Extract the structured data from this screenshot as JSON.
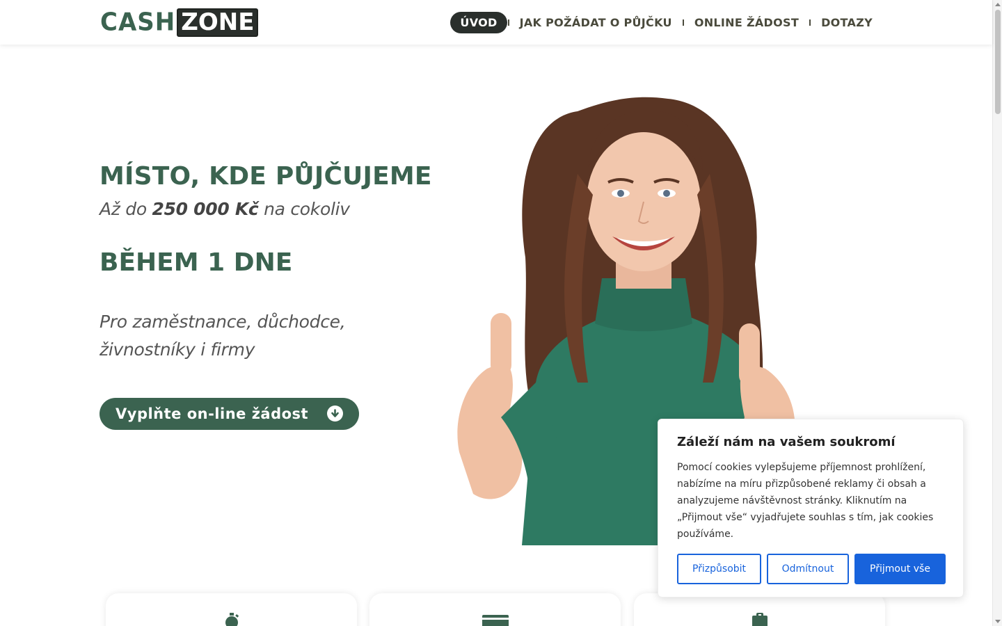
{
  "header": {
    "logo": {
      "part1": "CASH",
      "part2": "ZONE"
    },
    "nav": [
      {
        "label": "ÚVOD",
        "active": true
      },
      {
        "label": "JAK POŽÁDAT O PŮJČKU",
        "active": false
      },
      {
        "label": "ONLINE ŽÁDOST",
        "active": false
      },
      {
        "label": "DOTAZY",
        "active": false
      }
    ]
  },
  "hero": {
    "title": "MÍSTO, KDE PŮJČUJEME",
    "subtitle_pre": "Až do ",
    "subtitle_amount": "250 000 Kč",
    "subtitle_post": " na cokoliv",
    "title2": "BĚHEM 1 DNE",
    "description": "Pro zaměstnance, důchodce, živnostníky i firmy",
    "cta_label": "Vyplňte on-line žádost",
    "cta_icon": "arrow-down-circle-icon"
  },
  "cards": [
    {
      "icon": "stopwatch-icon"
    },
    {
      "icon": "credit-card-icon"
    },
    {
      "icon": "clipboard-icon"
    }
  ],
  "cookie": {
    "title": "Záleží nám na vašem soukromí",
    "text": "Pomocí cookies vylepšujeme příjemnost prohlížení, nabízíme na míru přizpůsobené reklamy či obsah a analyzujeme návštěvnost stránky. Kliknutím na „Přijmout vše“ vyjadřujete souhlas s tím, jak cookies používáme.",
    "customize_label": "Přizpůsobit",
    "reject_label": "Odmítnout",
    "accept_label": "Přijmout vše"
  },
  "colors": {
    "brand_green": "#3b6350",
    "dark": "#2a2f2c",
    "cookie_blue": "#1863dc"
  }
}
